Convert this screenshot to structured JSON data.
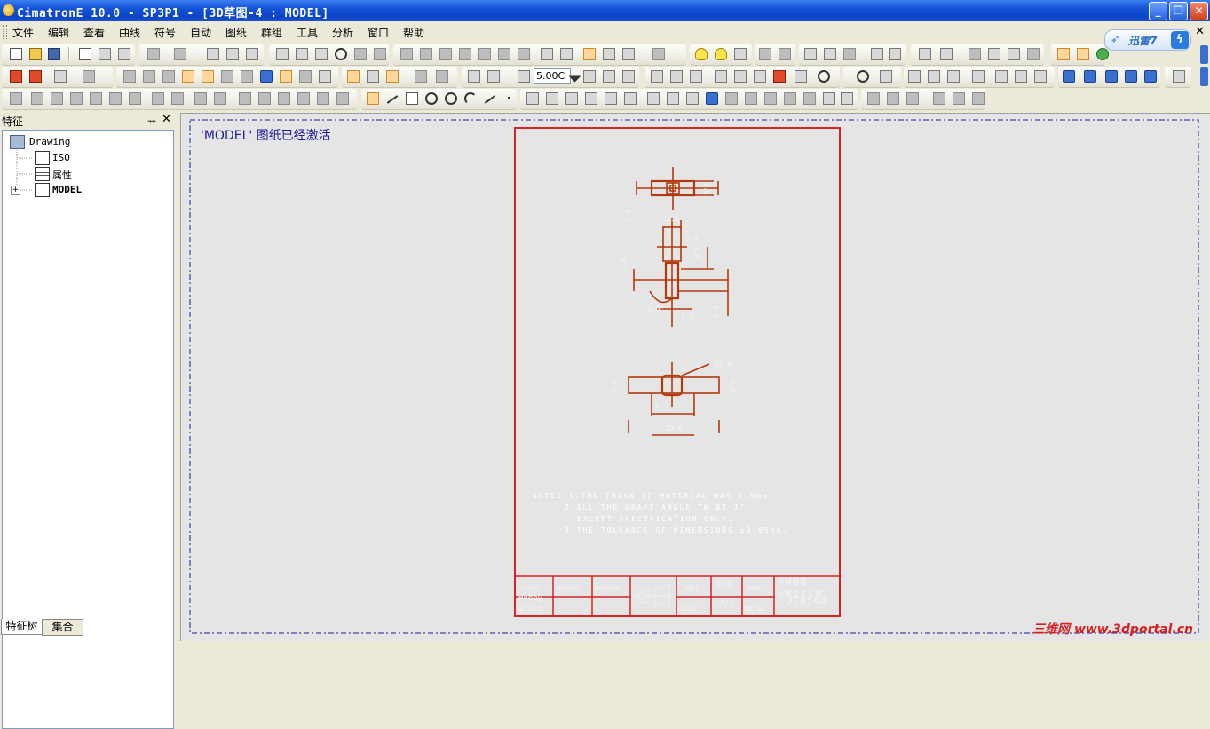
{
  "window": {
    "title": "CimatronE 10.0 - SP3P1 - [3D草图-4 : MODEL]"
  },
  "menu": [
    "文件",
    "编辑",
    "查看",
    "曲线",
    "符号",
    "自动",
    "图纸",
    "群组",
    "工具",
    "分析",
    "窗口",
    "帮助"
  ],
  "mdi_close": "✕",
  "xunlei": {
    "label": "迅雷7",
    "bolt": "ϟ"
  },
  "toolbar": {
    "scale_value": "5.00C"
  },
  "panel": {
    "title": "特征",
    "pin": "ᅲ",
    "close": "✕",
    "tree": [
      {
        "label": "Drawing",
        "level": 0
      },
      {
        "label": "ISO",
        "level": 1
      },
      {
        "label": "属性",
        "level": 1
      },
      {
        "label": "MODEL",
        "level": 1,
        "bold": true,
        "expand": "+"
      }
    ],
    "tabs": [
      "特征树",
      "集合"
    ]
  },
  "canvas": {
    "status_msg": "'MODEL' 图纸已经激活",
    "colors": {
      "border": "#d42424",
      "dim": "#b23a0e",
      "frame": "#1a1a9a",
      "notes": "#ffffff"
    }
  },
  "drawing": {
    "dims": [
      "9.6",
      "2.0",
      "3.6",
      "2.0",
      "3.0",
      "1.0",
      "9.0°",
      "0.8",
      "4.0",
      "R1.0",
      "3.6",
      "4.6",
      "5.3",
      "10.6"
    ],
    "notes": [
      "NOTES:1.THE THICK OF MATERIAL WAS 2.0mm.",
      "2.ALL THE DRAFT ANGLE TO BE 1°",
      "EXCEPT SPECIFICATION ONLY.",
      "3.THE TOLLANCE OF DIMENSIONS ±0.05mm."
    ],
    "title_block": {
      "design": "DESIGN",
      "checked": "CHECKED",
      "approved": "APPROVED",
      "designer": "Hobby",
      "date": "08.04.04",
      "unit": "UNIT",
      "unit_value": "m/m",
      "scale": "SCALE",
      "scale_value": "2/1",
      "name": "NAME",
      "dwg_no": "DWG.NO",
      "part_name": "KNOB SWITCH",
      "part_no": "JC8508"
    }
  },
  "watermark": {
    "cn": "三维网",
    "url": "www.3dportal.cn"
  }
}
